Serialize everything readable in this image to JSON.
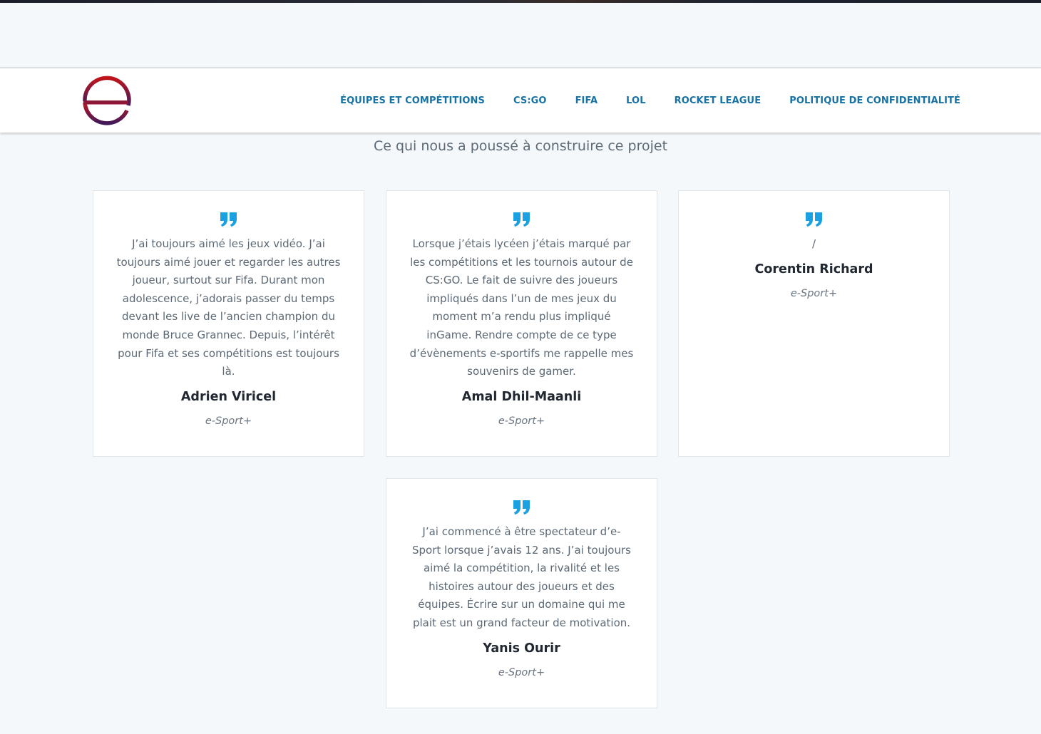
{
  "header": {
    "logo_icon": "esport-plus-logo",
    "nav": [
      {
        "label": "ÉQUIPES ET COMPÉTITIONS"
      },
      {
        "label": "CS:GO"
      },
      {
        "label": "FIFA"
      },
      {
        "label": "LOL"
      },
      {
        "label": "ROCKET LEAGUE"
      },
      {
        "label": "POLITIQUE DE CONFIDENTIALITÉ"
      }
    ]
  },
  "section": {
    "title": "Ce qui nous a poussé à construire ce projet"
  },
  "testimonials": [
    {
      "quote": "J’ai toujours aimé les jeux vidéo. J’ai toujours aimé jouer et regarder les autres joueur, surtout sur Fifa. Durant mon adolescence, j’adorais passer du temps devant les live de l’ancien champion du monde Bruce Grannec. Depuis, l’intérêt pour Fifa et ses compétitions est toujours là.",
      "name": "Adrien Viricel",
      "role": "e-Sport+"
    },
    {
      "quote": "Lorsque j’étais lycéen j’étais marqué par les compétitions et les tournois autour de CS:GO. Le fait de suivre des joueurs impliqués dans l’un de mes jeux du moment m’a rendu plus impliqué inGame. Rendre compte de ce type d’évènements e-sportifs me rappelle mes souvenirs de gamer.",
      "name": "Amal Dhil-Maanli",
      "role": "e-Sport+"
    },
    {
      "quote": "/",
      "name": "Corentin Richard",
      "role": "e-Sport+"
    },
    {
      "quote": "J’ai commencé à être spectateur d’e-Sport lorsque j’avais 12 ans. J’ai toujours aimé la compétition, la rivalité et les histoires autour des joueurs et des équipes. Écrire sur un domaine qui me plait est un grand facteur de motivation.",
      "name": "Yanis Ourir",
      "role": "e-Sport+"
    }
  ],
  "colors": {
    "accent": "#1ba0e2",
    "nav_link": "#1672a5",
    "logo_red": "#b3141c",
    "logo_purple": "#4a1c5a"
  }
}
